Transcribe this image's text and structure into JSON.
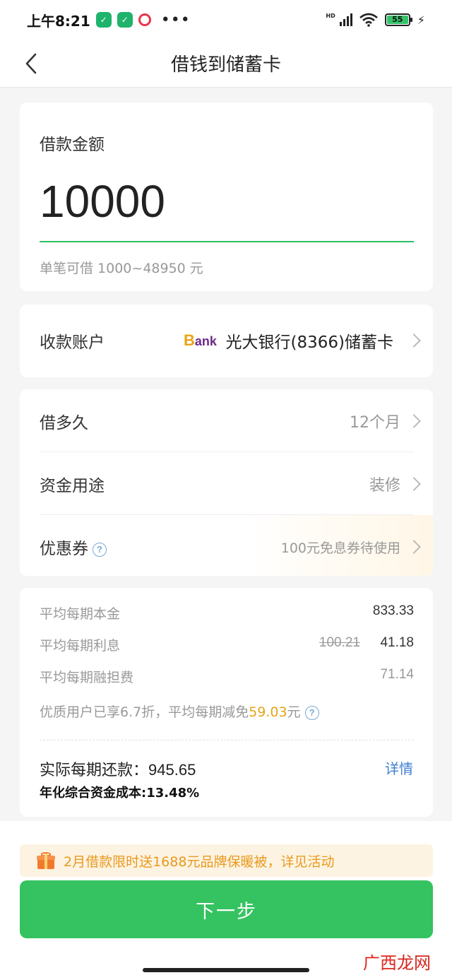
{
  "status_bar": {
    "time": "上午8:21",
    "battery": "55",
    "network": "HD",
    "more": "•••"
  },
  "nav": {
    "title": "借钱到储蓄卡"
  },
  "amount": {
    "label": "借款金额",
    "value": "10000",
    "hint": "单笔可借 1000~48950 元"
  },
  "account": {
    "label": "收款账户",
    "bank_logo_first": "B",
    "bank_logo_rest": "ank",
    "bank_name": "光大银行(8366)储蓄卡"
  },
  "options": {
    "term": {
      "label": "借多久",
      "value": "12个月"
    },
    "purpose": {
      "label": "资金用途",
      "value": "装修"
    },
    "coupon": {
      "label": "优惠券",
      "value": "100元免息券待使用",
      "help": "?"
    }
  },
  "details": {
    "principal": {
      "label": "平均每期本金",
      "value": "833.33"
    },
    "interest": {
      "label": "平均每期利息",
      "original": "100.21",
      "value": "41.18"
    },
    "guarantee": {
      "label": "平均每期融担费",
      "value": "71.14"
    },
    "discount_prefix": "优质用户已享6.7折，平均每期减免",
    "discount_amount": "59.03",
    "discount_suffix": "元",
    "discount_help": "?",
    "repay_label": "实际每期还款：",
    "repay_value": "945.65",
    "detail_link": "详情",
    "cost_line": "年化综合资金成本:13.48%"
  },
  "promo": {
    "text": "2月借款限时送1688元品牌保暖被，详见活动"
  },
  "next_button": "下一步",
  "watermark": {
    "part1": "广西",
    "part2": "龙网"
  },
  "colors": {
    "accent": "#34c360",
    "highlight": "#e8a317",
    "link": "#3f7fd0"
  }
}
